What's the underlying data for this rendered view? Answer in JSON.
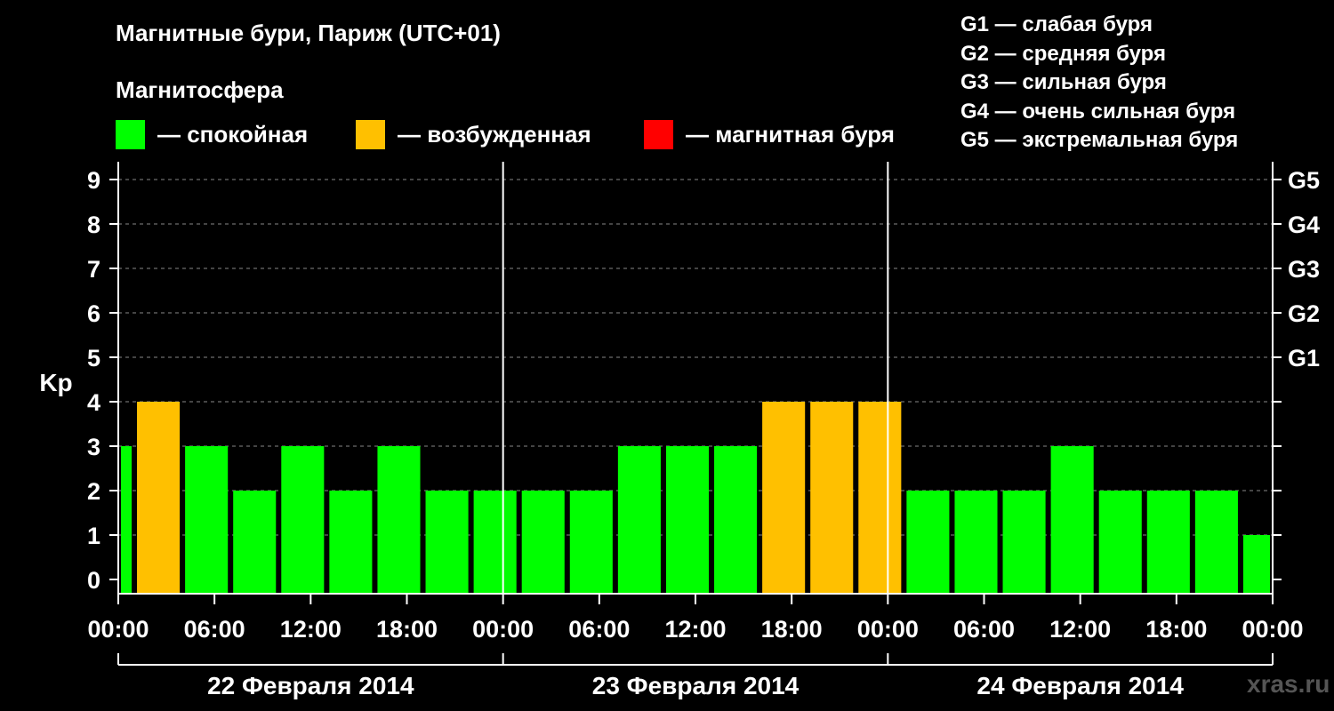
{
  "chart_data": {
    "type": "bar",
    "title": "Магнитные бури, Париж (UTC+01)",
    "section_label": "Магнитосфера",
    "legend": [
      {
        "label": "— спокойная",
        "color": "#00ff00"
      },
      {
        "label": "— возбужденная",
        "color": "#ffc000"
      },
      {
        "label": "— магнитная буря",
        "color": "#ff0000"
      }
    ],
    "g_legend": [
      "G1 — слабая буря",
      "G2 — средняя буря",
      "G3 — сильная буря",
      "G4 — очень сильная буря",
      "G5 — экстремальная буря"
    ],
    "ylabel": "Kp",
    "ylim": [
      0,
      9
    ],
    "yticks": [
      "0",
      "1",
      "2",
      "3",
      "4",
      "5",
      "6",
      "7",
      "8",
      "9"
    ],
    "right_ticks": [
      {
        "value": 5,
        "label": "G1"
      },
      {
        "value": 6,
        "label": "G2"
      },
      {
        "value": 7,
        "label": "G3"
      },
      {
        "value": 8,
        "label": "G4"
      },
      {
        "value": 9,
        "label": "G5"
      }
    ],
    "xtick_labels": [
      "00:00",
      "06:00",
      "12:00",
      "18:00",
      "00:00",
      "06:00",
      "12:00",
      "18:00",
      "00:00",
      "06:00",
      "12:00",
      "18:00",
      "00:00"
    ],
    "days": [
      "22 Февраля 2014",
      "23 Февраля 2014",
      "24 Февраля 2014"
    ],
    "grid": "dashed horizontal",
    "bars": [
      {
        "start": "22.02 00:00",
        "end": "22.02 01:00",
        "kp": 3,
        "status": "quiet"
      },
      {
        "start": "22.02 01:00",
        "end": "22.02 04:00",
        "kp": 4,
        "status": "active"
      },
      {
        "start": "22.02 04:00",
        "end": "22.02 07:00",
        "kp": 3,
        "status": "quiet"
      },
      {
        "start": "22.02 07:00",
        "end": "22.02 10:00",
        "kp": 2,
        "status": "quiet"
      },
      {
        "start": "22.02 10:00",
        "end": "22.02 13:00",
        "kp": 3,
        "status": "quiet"
      },
      {
        "start": "22.02 13:00",
        "end": "22.02 16:00",
        "kp": 2,
        "status": "quiet"
      },
      {
        "start": "22.02 16:00",
        "end": "22.02 19:00",
        "kp": 3,
        "status": "quiet"
      },
      {
        "start": "22.02 19:00",
        "end": "22.02 22:00",
        "kp": 2,
        "status": "quiet"
      },
      {
        "start": "22.02 22:00",
        "end": "23.02 01:00",
        "kp": 2,
        "status": "quiet"
      },
      {
        "start": "23.02 01:00",
        "end": "23.02 04:00",
        "kp": 2,
        "status": "quiet"
      },
      {
        "start": "23.02 04:00",
        "end": "23.02 07:00",
        "kp": 2,
        "status": "quiet"
      },
      {
        "start": "23.02 07:00",
        "end": "23.02 10:00",
        "kp": 3,
        "status": "quiet"
      },
      {
        "start": "23.02 10:00",
        "end": "23.02 13:00",
        "kp": 3,
        "status": "quiet"
      },
      {
        "start": "23.02 13:00",
        "end": "23.02 16:00",
        "kp": 3,
        "status": "quiet"
      },
      {
        "start": "23.02 16:00",
        "end": "23.02 19:00",
        "kp": 4,
        "status": "active"
      },
      {
        "start": "23.02 19:00",
        "end": "23.02 22:00",
        "kp": 4,
        "status": "active"
      },
      {
        "start": "23.02 22:00",
        "end": "24.02 01:00",
        "kp": 4,
        "status": "active"
      },
      {
        "start": "24.02 01:00",
        "end": "24.02 04:00",
        "kp": 2,
        "status": "quiet"
      },
      {
        "start": "24.02 04:00",
        "end": "24.02 07:00",
        "kp": 2,
        "status": "quiet"
      },
      {
        "start": "24.02 07:00",
        "end": "24.02 10:00",
        "kp": 2,
        "status": "quiet"
      },
      {
        "start": "24.02 10:00",
        "end": "24.02 13:00",
        "kp": 3,
        "status": "quiet"
      },
      {
        "start": "24.02 13:00",
        "end": "24.02 16:00",
        "kp": 2,
        "status": "quiet"
      },
      {
        "start": "24.02 16:00",
        "end": "24.02 19:00",
        "kp": 2,
        "status": "quiet"
      },
      {
        "start": "24.02 19:00",
        "end": "24.02 22:00",
        "kp": 2,
        "status": "quiet"
      },
      {
        "start": "24.02 22:00",
        "end": "25.02 00:00",
        "kp": 1,
        "status": "quiet"
      }
    ],
    "status_colors": {
      "quiet": "#00ff00",
      "active": "#ffc000",
      "storm": "#ff0000"
    },
    "watermark": "xras.ru"
  }
}
